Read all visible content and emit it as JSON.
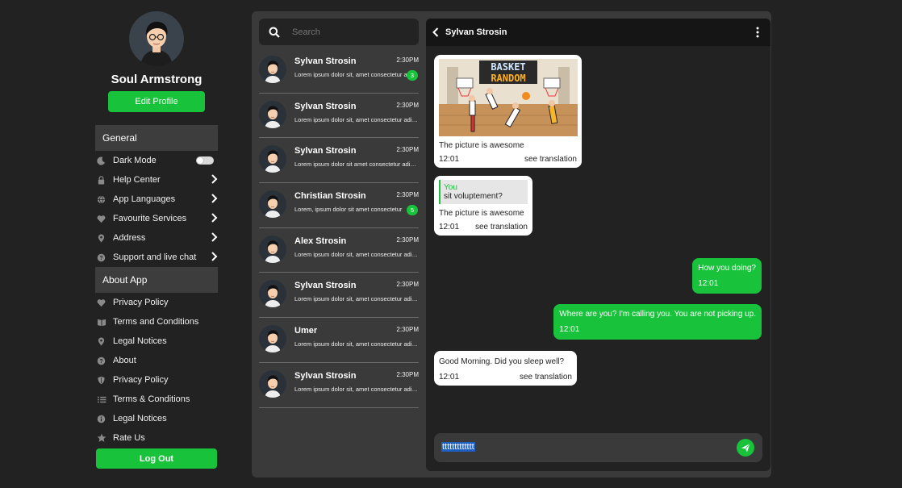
{
  "profile": {
    "name": "Soul Armstrong",
    "edit_label": "Edit Profile"
  },
  "sidebar": {
    "general_header": "General",
    "general_items": [
      {
        "label": "Dark Mode",
        "icon": "moon-icon"
      },
      {
        "label": "Help Center",
        "icon": "lock-icon"
      },
      {
        "label": "App Languages",
        "icon": "globe-icon"
      },
      {
        "label": "Favourite Services",
        "icon": "heart-icon"
      },
      {
        "label": "Address",
        "icon": "map-pin-icon"
      },
      {
        "label": "Support and live chat",
        "icon": "question-circle-icon"
      }
    ],
    "about_header": "About App",
    "about_items": [
      {
        "label": "Privacy Policy",
        "icon": "heart-icon"
      },
      {
        "label": "Terms and Conditions",
        "icon": "book-icon"
      },
      {
        "label": "Legal Notices",
        "icon": "map-pin-icon"
      },
      {
        "label": "About",
        "icon": "question-circle-icon"
      },
      {
        "label": "Privacy Policy",
        "icon": "shield-icon"
      },
      {
        "label": "Terms & Conditions",
        "icon": "list-icon"
      },
      {
        "label": "Legal Notices",
        "icon": "info-circle-icon"
      },
      {
        "label": "Rate Us",
        "icon": "star-icon"
      }
    ],
    "logout_label": "Log Out"
  },
  "search": {
    "placeholder": "Search"
  },
  "conversations": [
    {
      "name": "Sylvan Strosin",
      "time": "2:30PM",
      "preview": "Lorem ipsum dolor sit, amet consectetur adipisicing",
      "badge": "3"
    },
    {
      "name": "Sylvan Strosin",
      "time": "2:30PM",
      "preview": "Lorem ipsum dolor sit, amet consectetur adipisicing",
      "badge": ""
    },
    {
      "name": "Sylvan Strosin",
      "time": "2:30PM",
      "preview": "Lorem ipsum dolor sit amet consectetur adipisicing",
      "badge": ""
    },
    {
      "name": "Christian Strosin",
      "time": "2:30PM",
      "preview": "Lorem, ipsum dolor sit amet consectetur",
      "badge": "5"
    },
    {
      "name": "Alex Strosin",
      "time": "2:30PM",
      "preview": "Lorem ipsum dolor sit, amet consectetur adipisicing",
      "badge": ""
    },
    {
      "name": "Sylvan Strosin",
      "time": "2:30PM",
      "preview": "Lorem ipsum dolor sit, amet consectetur adipisicing",
      "badge": ""
    },
    {
      "name": "Umer",
      "time": "2:30PM",
      "preview": "Lorem ipsum dolor sit, amet consectetur adipisicing",
      "badge": ""
    },
    {
      "name": "Sylvan Strosin",
      "time": "2:30PM",
      "preview": "Lorem ipsum dolor sit, amet consectetur adipisicing",
      "badge": ""
    }
  ],
  "chat": {
    "title": "Sylvan Strosin",
    "image_title_line1": "BASKET",
    "image_title_line2": "RANDOM",
    "messages": {
      "m1": {
        "text": "The picture is awesome",
        "time": "12:01",
        "action": "see translation"
      },
      "m2": {
        "reply_to": "You",
        "reply_text": "sit voluptement?",
        "text": "The picture is awesome",
        "time": "12:01",
        "action": "see translation"
      },
      "m3": {
        "text": "How you doing?",
        "time": "12:01"
      },
      "m4": {
        "text": "Where are you? I'm calling you. You are not picking up.",
        "time": "12:01"
      },
      "m5": {
        "text": "Good Morning. Did you sleep well?",
        "time": "12:01",
        "action": "see translation"
      }
    },
    "composer_value": "ttttttttttttt"
  },
  "colors": {
    "accent": "#19c23b",
    "background": "#222222",
    "panel": "#3a3a3a"
  }
}
